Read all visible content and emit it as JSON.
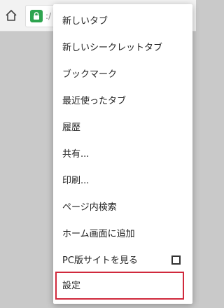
{
  "toolbar": {
    "url_text": ":/",
    "icons": {
      "home": "home-icon",
      "lock": "lock-icon"
    }
  },
  "menu": {
    "items": [
      {
        "label": "新しいタブ"
      },
      {
        "label": "新しいシークレットタブ"
      },
      {
        "label": "ブックマーク"
      },
      {
        "label": "最近使ったタブ"
      },
      {
        "label": "履歴"
      },
      {
        "label": "共有..."
      },
      {
        "label": "印刷..."
      },
      {
        "label": "ページ内検索"
      },
      {
        "label": "ホーム画面に追加"
      },
      {
        "label": "PC版サイトを見る",
        "checkbox_checked": false
      },
      {
        "label": "設定",
        "highlighted": true
      }
    ],
    "highlight_color": "#d0293c"
  }
}
